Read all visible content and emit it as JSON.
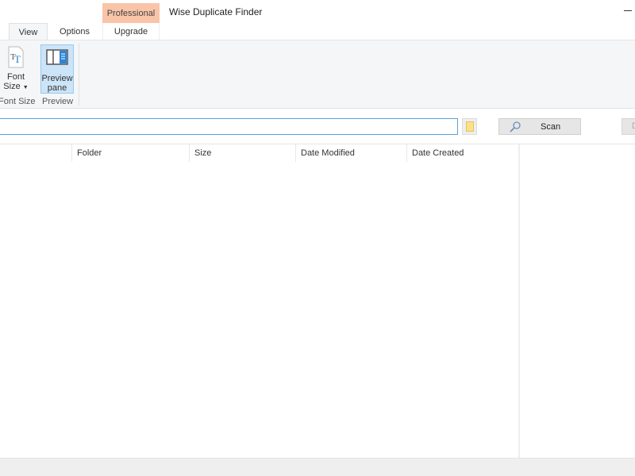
{
  "app": {
    "title": "Wise Duplicate Finder",
    "edition_badge": "Professional"
  },
  "tabs": [
    {
      "label": "View",
      "active": true
    },
    {
      "label": "Options",
      "active": false
    },
    {
      "label": "Upgrade",
      "active": false
    }
  ],
  "ribbon": {
    "font_size": {
      "line1": "Font",
      "line2": "Size",
      "icon": "font-size-icon",
      "group": "Font Size"
    },
    "preview_pane": {
      "line1": "Preview",
      "line2": "pane",
      "icon": "preview-pane-icon",
      "group": "Preview",
      "selected": true
    }
  },
  "toolbar": {
    "path_value": "",
    "scan_label": "Scan",
    "cut_button_label": "D"
  },
  "table": {
    "columns": [
      "",
      "Folder",
      "Size",
      "Date Modified",
      "Date Created"
    ],
    "rows": []
  },
  "colors": {
    "accent": "#5aa0d8",
    "badge": "#f9c4a8",
    "selected": "#cce4f7"
  }
}
